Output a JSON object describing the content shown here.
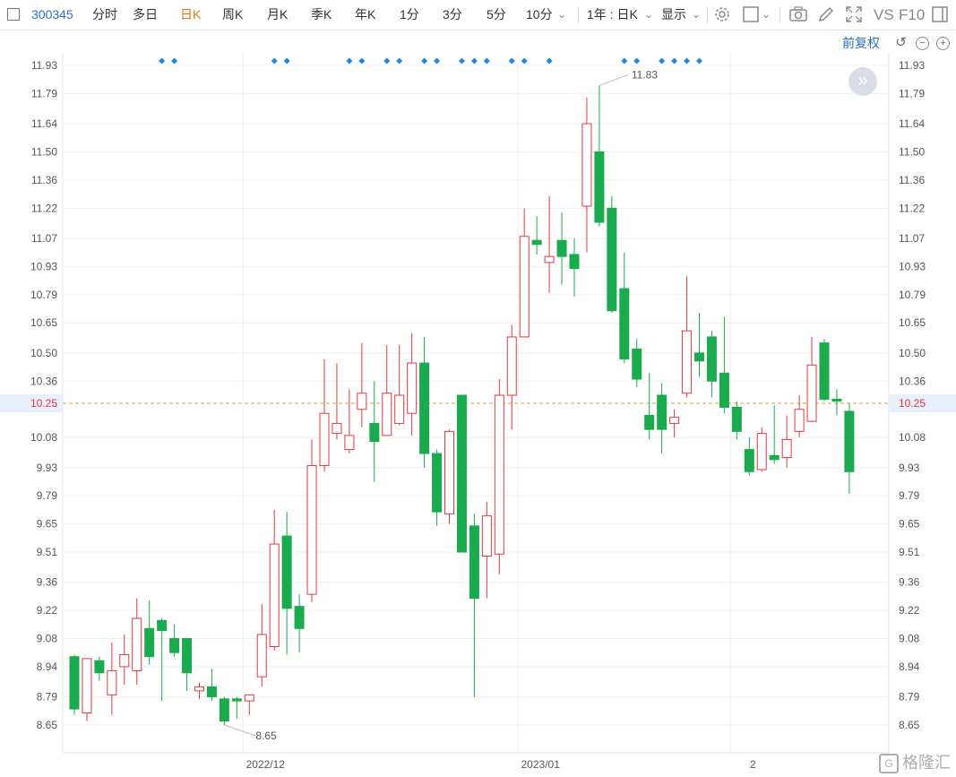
{
  "toolbar": {
    "code": "300345",
    "items": [
      "分时",
      "多日",
      "日K",
      "周K",
      "月K",
      "季K",
      "年K",
      "1分",
      "3分",
      "5分",
      "10分"
    ],
    "active": "日K",
    "period_select": "1年 : 日K",
    "display_label": "显示",
    "vs_label": "VS",
    "f10_label": "F10"
  },
  "adjust_label": "前复权",
  "icons": [
    "checkbox-icon",
    "chevron-down-icon",
    "gear-icon",
    "square-icon",
    "camera-icon",
    "pencil-icon",
    "fullscreen-icon",
    "panel-icon",
    "undo-icon",
    "zoom-out-icon",
    "zoom-in-icon",
    "expand-icon"
  ],
  "colors": {
    "up": "#e0393e",
    "down": "#1aab4e",
    "ref_line": "#d4a040",
    "ref_bg": "#e8f0fb",
    "marker": "#1e88e5"
  },
  "watermark": "格隆汇",
  "chart_data": {
    "type": "candlestick",
    "ylim": [
      8.58,
      12.0
    ],
    "y_ticks": [
      "11.93",
      "11.79",
      "11.64",
      "11.50",
      "11.36",
      "11.22",
      "11.07",
      "10.93",
      "10.79",
      "10.65",
      "10.50",
      "10.36",
      "10.25",
      "10.08",
      "9.93",
      "9.79",
      "9.65",
      "9.51",
      "9.36",
      "9.22",
      "9.08",
      "8.94",
      "8.79",
      "8.65"
    ],
    "x_labels": [
      {
        "label": "2022/12",
        "index": 14
      },
      {
        "label": "2023/01",
        "index": 36
      },
      {
        "label": "2",
        "index": 53
      }
    ],
    "ref_price": "10.25",
    "annotations": [
      {
        "label": "11.83",
        "index": 42,
        "value": 11.83
      },
      {
        "label": "8.65",
        "index": 12,
        "value": 8.65
      }
    ],
    "marker_indices": [
      7,
      8,
      16,
      17,
      22,
      23,
      25,
      26,
      28,
      29,
      31,
      32,
      33,
      35,
      36,
      38,
      44,
      45,
      47,
      48,
      49,
      50
    ],
    "candles": [
      {
        "o": 8.99,
        "h": 9.0,
        "c": 8.73,
        "l": 8.7
      },
      {
        "o": 8.71,
        "h": 8.98,
        "c": 8.98,
        "l": 8.67
      },
      {
        "o": 8.97,
        "h": 8.99,
        "c": 8.91,
        "l": 8.87
      },
      {
        "o": 8.8,
        "h": 9.06,
        "c": 8.92,
        "l": 8.7
      },
      {
        "o": 8.94,
        "h": 9.1,
        "c": 9.0,
        "l": 8.85
      },
      {
        "o": 8.92,
        "h": 9.28,
        "c": 9.18,
        "l": 8.85
      },
      {
        "o": 9.13,
        "h": 9.27,
        "c": 8.99,
        "l": 8.95
      },
      {
        "o": 9.17,
        "h": 9.18,
        "c": 9.12,
        "l": 8.77
      },
      {
        "o": 9.08,
        "h": 9.15,
        "c": 9.01,
        "l": 8.99
      },
      {
        "o": 9.08,
        "h": 9.08,
        "c": 8.91,
        "l": 8.82
      },
      {
        "o": 8.82,
        "h": 8.86,
        "c": 8.84,
        "l": 8.78
      },
      {
        "o": 8.84,
        "h": 8.93,
        "c": 8.79,
        "l": 8.77
      },
      {
        "o": 8.78,
        "h": 8.79,
        "c": 8.67,
        "l": 8.65
      },
      {
        "o": 8.78,
        "h": 8.79,
        "c": 8.77,
        "l": 8.68
      },
      {
        "o": 8.77,
        "h": 8.8,
        "c": 8.8,
        "l": 8.7
      },
      {
        "o": 8.89,
        "h": 9.25,
        "c": 9.1,
        "l": 8.84
      },
      {
        "o": 9.04,
        "h": 9.72,
        "c": 9.55,
        "l": 9.02
      },
      {
        "o": 9.59,
        "h": 9.71,
        "c": 9.23,
        "l": 9.0
      },
      {
        "o": 9.24,
        "h": 9.3,
        "c": 9.13,
        "l": 9.01
      },
      {
        "o": 9.3,
        "h": 10.07,
        "c": 9.94,
        "l": 9.26
      },
      {
        "o": 9.94,
        "h": 10.47,
        "c": 10.2,
        "l": 9.91
      },
      {
        "o": 10.1,
        "h": 10.45,
        "c": 10.15,
        "l": 10.07
      },
      {
        "o": 10.02,
        "h": 10.32,
        "c": 10.09,
        "l": 10.0
      },
      {
        "o": 10.22,
        "h": 10.55,
        "c": 10.3,
        "l": 10.13
      },
      {
        "o": 10.15,
        "h": 10.36,
        "c": 10.06,
        "l": 9.86
      },
      {
        "o": 10.09,
        "h": 10.54,
        "c": 10.3,
        "l": 10.09
      },
      {
        "o": 10.15,
        "h": 10.54,
        "c": 10.29,
        "l": 10.14
      },
      {
        "o": 10.2,
        "h": 10.6,
        "c": 10.45,
        "l": 10.09
      },
      {
        "o": 10.45,
        "h": 10.58,
        "c": 10.0,
        "l": 9.93
      },
      {
        "o": 10.0,
        "h": 10.02,
        "c": 9.71,
        "l": 9.64
      },
      {
        "o": 9.7,
        "h": 10.12,
        "c": 10.11,
        "l": 9.65
      },
      {
        "o": 10.29,
        "h": 10.29,
        "c": 9.51,
        "l": 9.51
      },
      {
        "o": 9.64,
        "h": 9.7,
        "c": 9.28,
        "l": 8.79
      },
      {
        "o": 9.49,
        "h": 9.76,
        "c": 9.69,
        "l": 9.28
      },
      {
        "o": 9.5,
        "h": 10.37,
        "c": 10.29,
        "l": 9.4
      },
      {
        "o": 10.29,
        "h": 10.64,
        "c": 10.58,
        "l": 10.12
      },
      {
        "o": 10.58,
        "h": 11.22,
        "c": 11.08,
        "l": 10.58
      },
      {
        "o": 11.06,
        "h": 11.18,
        "c": 11.04,
        "l": 10.99
      },
      {
        "o": 10.95,
        "h": 11.28,
        "c": 10.98,
        "l": 10.8
      },
      {
        "o": 11.06,
        "h": 11.2,
        "c": 10.98,
        "l": 10.84
      },
      {
        "o": 10.99,
        "h": 11.07,
        "c": 10.92,
        "l": 10.78
      },
      {
        "o": 11.23,
        "h": 11.77,
        "c": 11.64,
        "l": 11.0
      },
      {
        "o": 11.5,
        "h": 11.83,
        "c": 11.15,
        "l": 11.13
      },
      {
        "o": 11.22,
        "h": 11.28,
        "c": 10.71,
        "l": 10.7
      },
      {
        "o": 10.82,
        "h": 11.0,
        "c": 10.47,
        "l": 10.45
      },
      {
        "o": 10.52,
        "h": 10.57,
        "c": 10.37,
        "l": 10.33
      },
      {
        "o": 10.19,
        "h": 10.4,
        "c": 10.12,
        "l": 10.07
      },
      {
        "o": 10.29,
        "h": 10.35,
        "c": 10.12,
        "l": 10.0
      },
      {
        "o": 10.15,
        "h": 10.22,
        "c": 10.18,
        "l": 10.08
      },
      {
        "o": 10.3,
        "h": 10.88,
        "c": 10.61,
        "l": 10.28
      },
      {
        "o": 10.5,
        "h": 10.7,
        "c": 10.46,
        "l": 10.38
      },
      {
        "o": 10.58,
        "h": 10.61,
        "c": 10.36,
        "l": 10.28
      },
      {
        "o": 10.4,
        "h": 10.68,
        "c": 10.23,
        "l": 10.2
      },
      {
        "o": 10.23,
        "h": 10.26,
        "c": 10.11,
        "l": 10.07
      },
      {
        "o": 10.02,
        "h": 10.08,
        "c": 9.91,
        "l": 9.89
      },
      {
        "o": 9.92,
        "h": 10.13,
        "c": 10.1,
        "l": 9.91
      },
      {
        "o": 9.99,
        "h": 10.24,
        "c": 9.97,
        "l": 9.95
      },
      {
        "o": 9.98,
        "h": 10.19,
        "c": 10.07,
        "l": 9.93
      },
      {
        "o": 10.11,
        "h": 10.29,
        "c": 10.22,
        "l": 10.08
      },
      {
        "o": 10.16,
        "h": 10.58,
        "c": 10.44,
        "l": 10.16
      },
      {
        "o": 10.55,
        "h": 10.57,
        "c": 10.27,
        "l": 10.26
      },
      {
        "o": 10.27,
        "h": 10.32,
        "c": 10.26,
        "l": 10.19
      },
      {
        "o": 10.21,
        "h": 10.25,
        "c": 9.91,
        "l": 9.8
      }
    ]
  }
}
